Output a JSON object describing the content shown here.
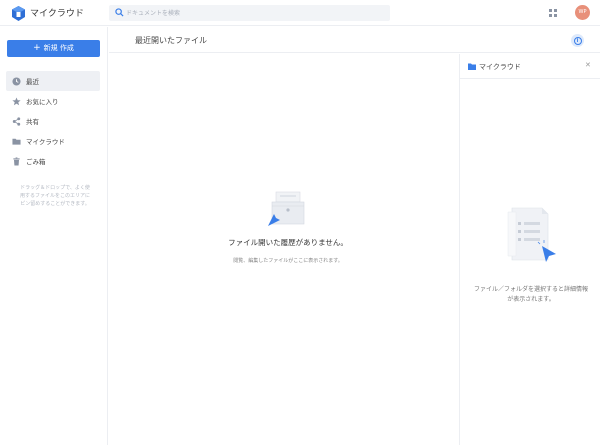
{
  "app": {
    "title": "マイクラウド",
    "brand_color": "#3a7ee8"
  },
  "search": {
    "placeholder": "ドキュメントを検索"
  },
  "user": {
    "avatar_initials": "WP",
    "avatar_color": "#e8907a"
  },
  "sidebar": {
    "new_button_label": "新規 作成",
    "items": [
      {
        "label": "最近",
        "icon": "clock-icon",
        "active": true
      },
      {
        "label": "お気に入り",
        "icon": "star-icon",
        "active": false
      },
      {
        "label": "共有",
        "icon": "share-icon",
        "active": false
      },
      {
        "label": "マイクラウド",
        "icon": "folder-icon",
        "active": false
      },
      {
        "label": "ごみ箱",
        "icon": "trash-icon",
        "active": false
      }
    ],
    "drop_hint": "ドラッグ＆ドロップで、よく使用するファイルをこのエリアにピン留めすることができます。"
  },
  "main": {
    "title": "最近開いたファイル",
    "empty_title": "ファイル開いた履歴がありません。",
    "empty_subtitle": "閲覧、編集したファイルがここに表示されます。"
  },
  "detail_panel": {
    "title": "マイクラウド",
    "message": "ファイル／フォルダを選択すると詳細情報が表示されます。"
  }
}
